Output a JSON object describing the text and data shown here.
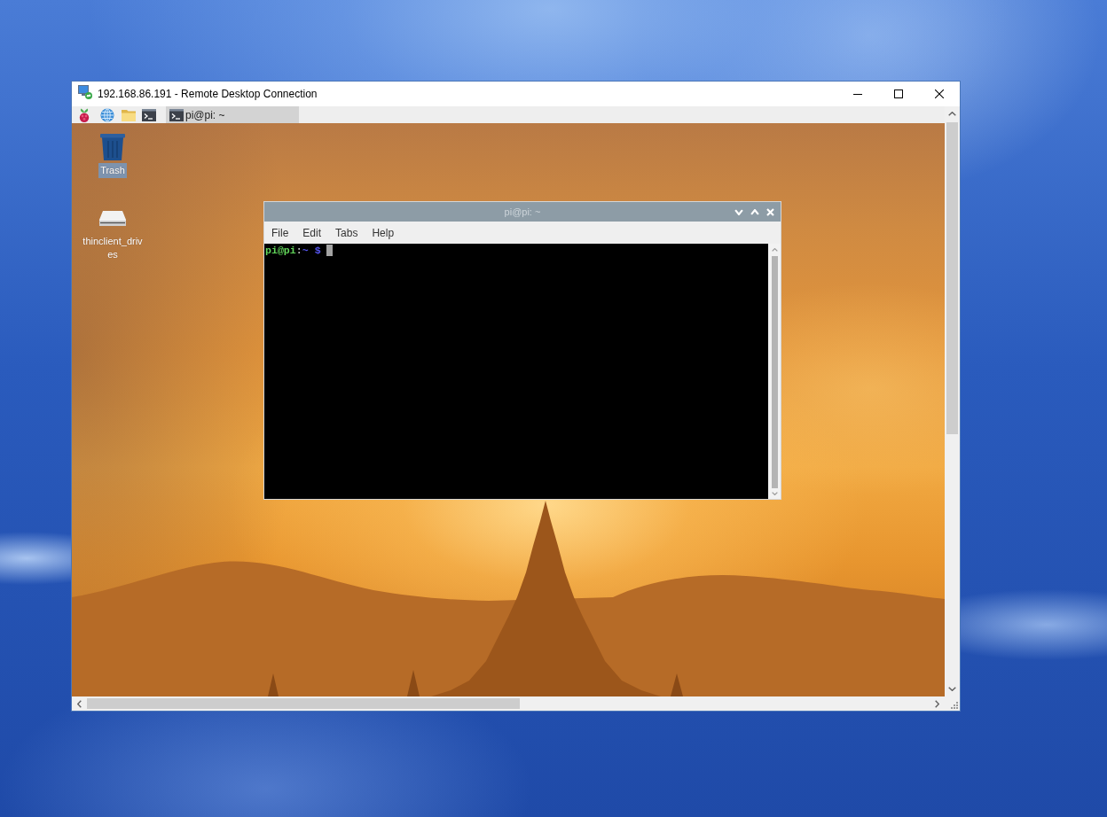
{
  "window": {
    "title": "192.168.86.191 - Remote Desktop Connection"
  },
  "taskbar": {
    "tasks": [
      {
        "label": "pi@pi: ~",
        "active": true
      }
    ]
  },
  "desktop_icons": [
    {
      "kind": "trash",
      "label": "Trash",
      "selected": true
    },
    {
      "kind": "drive",
      "label": "thinclient_drives",
      "selected": false
    }
  ],
  "terminal": {
    "title": "pi@pi: ~",
    "menu": [
      "File",
      "Edit",
      "Tabs",
      "Help"
    ],
    "prompt": {
      "user_host": "pi@pi",
      "separator": ":",
      "path": "~",
      "symbol": "$"
    }
  }
}
